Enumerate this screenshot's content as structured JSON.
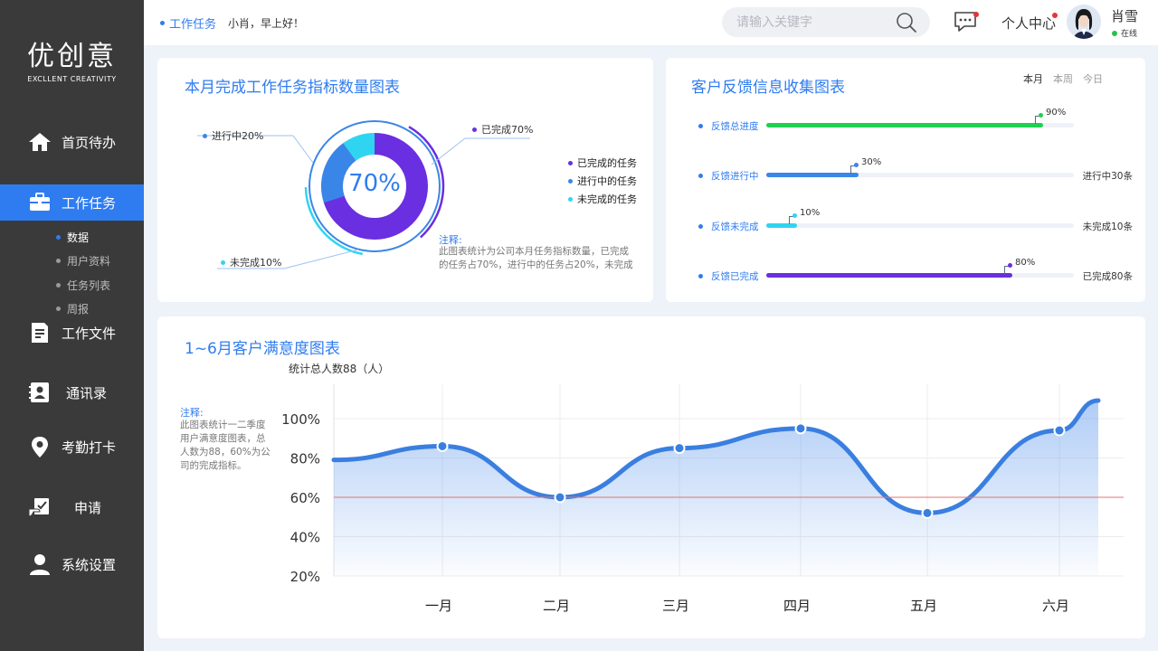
{
  "sidebar": {
    "logo_main": "优创意",
    "logo_sub": "EXCLLENT CREATIVITY",
    "nav": [
      {
        "label": "首页待办",
        "icon": "home-icon",
        "active": false
      },
      {
        "label": "工作任务",
        "icon": "briefcase-icon",
        "active": true
      },
      {
        "label": "工作文件",
        "icon": "document-icon",
        "active": false
      },
      {
        "label": "通讯录",
        "icon": "contacts-icon",
        "active": false
      },
      {
        "label": "考勤打卡",
        "icon": "location-pin-icon",
        "active": false
      },
      {
        "label": "申请",
        "icon": "application-icon",
        "active": false
      },
      {
        "label": "系统设置",
        "icon": "user-settings-icon",
        "active": false
      }
    ],
    "sub_nav": [
      {
        "label": "数据",
        "active": true
      },
      {
        "label": "用户资料",
        "active": false
      },
      {
        "label": "任务列表",
        "active": false
      },
      {
        "label": "周报",
        "active": false
      }
    ]
  },
  "topbar": {
    "breadcrumb": "工作任务",
    "greeting": "小肖，早上好！",
    "search_placeholder": "请输入关键字",
    "personal_center": "个人中心",
    "user_name": "肖雪",
    "user_status": "在线"
  },
  "task_card": {
    "title": "本月完成工作任务指标数量图表",
    "center_value": "70%",
    "label_in_progress": "进行中20%",
    "label_completed": "已完成70%",
    "label_incomplete": "未完成10%",
    "legend": [
      "已完成的任务",
      "进行中的任务",
      "未完成的任务"
    ],
    "note_title": "注释:",
    "note_text": "此图表统计为公司本月任务指标数量，已完成的任务占70%，进行中的任务占20%，未完成",
    "colors": {
      "completed": "#6a2fe0",
      "in_progress": "#3a86e8",
      "incomplete": "#2fd5f0"
    }
  },
  "feedback_card": {
    "title": "客户反馈信息收集图表",
    "periods": [
      {
        "label": "本月",
        "active": true
      },
      {
        "label": "本周",
        "active": false
      },
      {
        "label": "今日",
        "active": false
      }
    ],
    "rows": [
      {
        "label": "反馈总进度",
        "value": 0.9,
        "pct": "90%",
        "right": "",
        "color": "#1ed052"
      },
      {
        "label": "反馈进行中",
        "value": 0.3,
        "pct": "30%",
        "right": "进行中30条",
        "color": "#3a86e8"
      },
      {
        "label": "反馈未完成",
        "value": 0.1,
        "pct": "10%",
        "right": "未完成10条",
        "color": "#2fd5f0"
      },
      {
        "label": "反馈已完成",
        "value": 0.8,
        "pct": "80%",
        "right": "已完成80条",
        "color": "#6a2fe0"
      }
    ]
  },
  "satisfaction_card": {
    "title": "1~6月客户满意度图表",
    "stat_title": "统计总人数88（人）",
    "note_title": "注释:",
    "note_text": "此图表统计一二季度用户满意度图表，总人数为88，60%为公司的完成指标。"
  },
  "chart_data": [
    {
      "type": "pie",
      "categories": [
        "已完成的任务",
        "进行中的任务",
        "未完成的任务"
      ],
      "values": [
        70,
        20,
        10
      ],
      "colors": [
        "#6a2fe0",
        "#3a86e8",
        "#2fd5f0"
      ]
    },
    {
      "type": "area",
      "categories": [
        "一月",
        "二月",
        "三月",
        "四月",
        "五月",
        "六月"
      ],
      "values": [
        86,
        60,
        85,
        95,
        52,
        94
      ],
      "yticks": [
        "20%",
        "40%",
        "60%",
        "80%",
        "100%"
      ],
      "ylim": [
        20,
        100
      ],
      "target": 60,
      "line_color": "#3a7fe0",
      "target_color": "#e57373",
      "grid": true
    }
  ]
}
